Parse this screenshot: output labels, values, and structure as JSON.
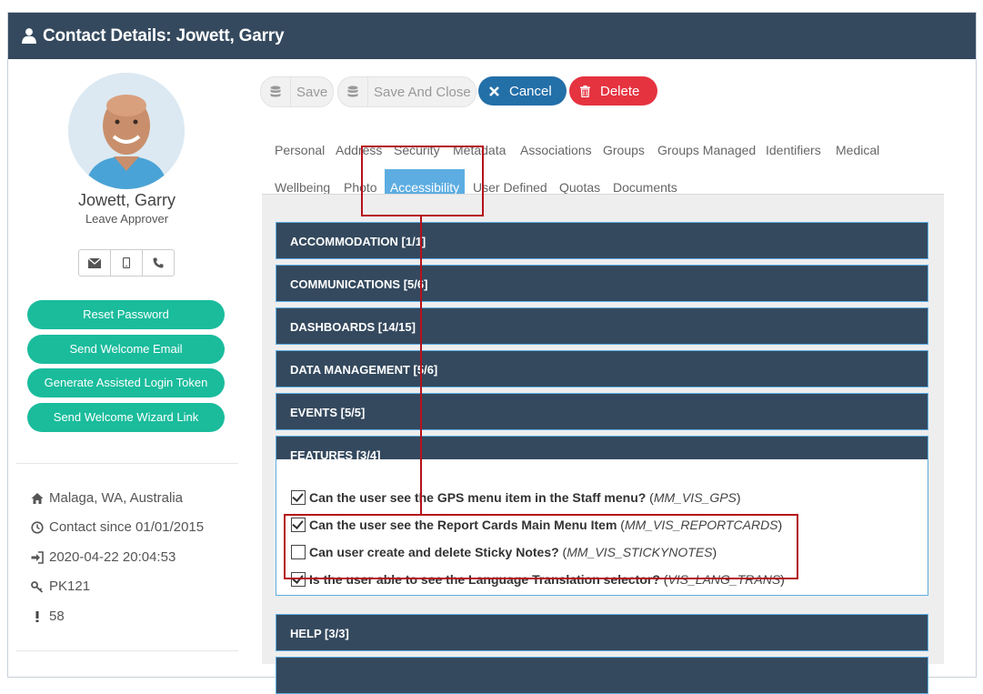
{
  "header": {
    "title": "Contact Details: Jowett, Garry"
  },
  "profile": {
    "name": "Jowett, Garry",
    "role": "Leave Approver",
    "buttons": [
      "Reset Password",
      "Send Welcome Email",
      "Generate Assisted Login Token",
      "Send Welcome Wizard Link"
    ],
    "info": {
      "location": "Malaga, WA, Australia",
      "contact_since": "Contact since 01/01/2015",
      "last_login": "2020-04-22 20:04:53",
      "key": "PK121",
      "alert": "58"
    }
  },
  "actions": {
    "save": "Save",
    "save_close": "Save And Close",
    "cancel": "Cancel",
    "delete": "Delete"
  },
  "tabs": {
    "row1": [
      "Personal",
      "Address",
      "Security",
      "Metadata",
      "Associations",
      "Groups",
      "Groups Managed",
      "Identifiers",
      "Medical"
    ],
    "row2": [
      "Wellbeing",
      "Photo",
      "Accessibility",
      "User Defined",
      "Quotas",
      "Documents"
    ],
    "active": "Accessibility"
  },
  "panels": {
    "accommodation": "ACCOMMODATION [1/1]",
    "communications": "COMMUNICATIONS [5/6]",
    "dashboards": "DASHBOARDS [14/15]",
    "data_management": "DATA MANAGEMENT [5/6]",
    "events": "EVENTS [5/5]",
    "features": "FEATURES [3/4]",
    "help": "HELP [3/3]"
  },
  "features": [
    {
      "question": "Can the user see the GPS menu item in the Staff menu?",
      "code": "MM_VIS_GPS",
      "checked": true
    },
    {
      "question": "Can the user see the Report Cards Main Menu Item",
      "code": "MM_VIS_REPORTCARDS",
      "checked": true
    },
    {
      "question": "Can user create and delete Sticky Notes?",
      "code": "MM_VIS_STICKYNOTES",
      "checked": false
    },
    {
      "question": "Is the user able to see the Language Translation selector?",
      "code": "VIS_LANG_TRANS",
      "checked": true
    }
  ],
  "colors": {
    "header": "#34495e",
    "accent": "#1abc9c",
    "active_tab": "#5dade2",
    "annotation": "#b5121b"
  }
}
